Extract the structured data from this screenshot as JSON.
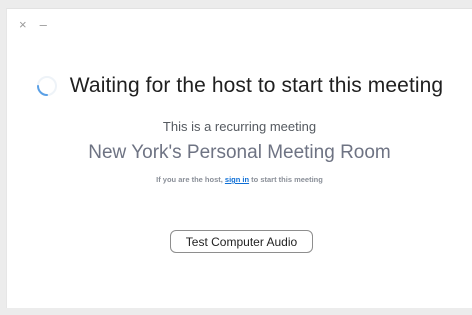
{
  "window_controls": {
    "close": "×",
    "minimize": "–"
  },
  "status": {
    "title": "Waiting for the host to start this meeting"
  },
  "meeting": {
    "recurring_text": "This is a recurring meeting",
    "room_name": "New York's Personal Meeting Room"
  },
  "host_note": {
    "prefix": "If you are the host, ",
    "link": "sign in",
    "suffix": " to start this meeting"
  },
  "actions": {
    "test_audio_label": "Test Computer Audio"
  },
  "colors": {
    "spinner": "#5aa0e6",
    "link": "#0e6fd6"
  }
}
